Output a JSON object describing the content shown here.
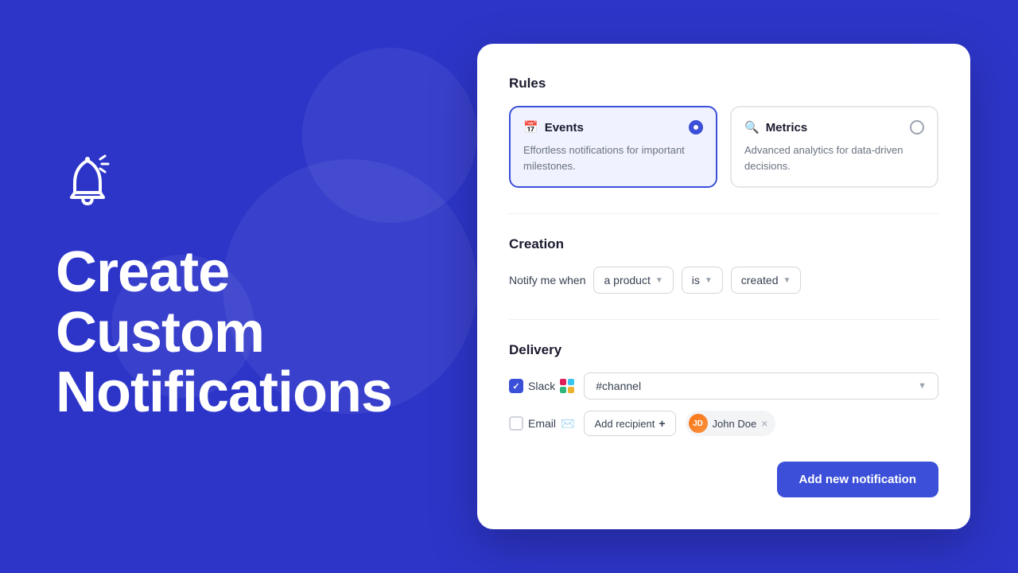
{
  "hero": {
    "title": "Create Custom Notifications"
  },
  "card": {
    "rules_section": {
      "title": "Rules",
      "events_card": {
        "title": "Events",
        "description": "Effortless notifications for important milestones.",
        "selected": true
      },
      "metrics_card": {
        "title": "Metrics",
        "description": "Advanced analytics for data-driven decisions.",
        "selected": false
      }
    },
    "creation_section": {
      "title": "Creation",
      "label": "Notify me when",
      "dropdown1": "a product",
      "dropdown2": "is",
      "dropdown3": "created"
    },
    "delivery_section": {
      "title": "Delivery",
      "slack": {
        "label": "Slack",
        "checked": true,
        "channel": "#channel"
      },
      "email": {
        "label": "Email",
        "checked": false,
        "add_recipient_label": "Add recipient",
        "recipient_name": "John Doe",
        "recipient_initials": "JD"
      }
    },
    "add_button_label": "Add new notification"
  }
}
